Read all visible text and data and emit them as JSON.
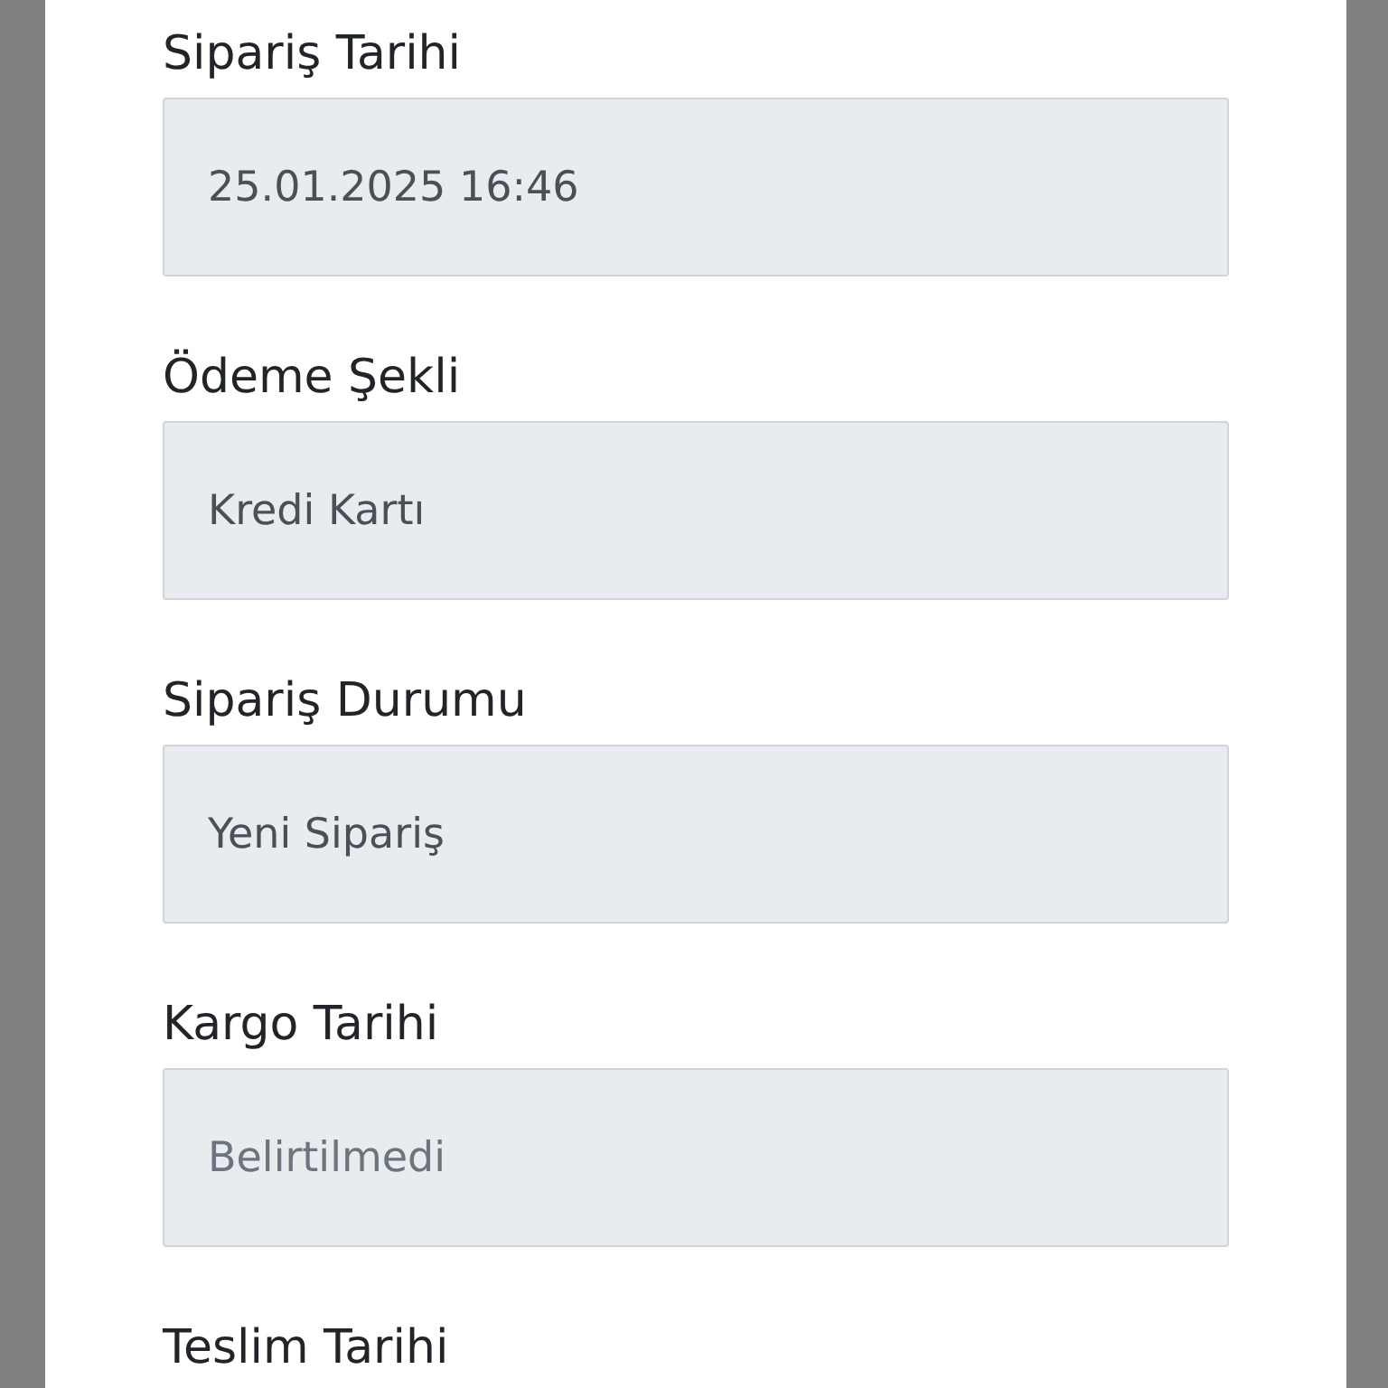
{
  "fields": [
    {
      "label": "Sipariş Tarihi",
      "value": "25.01.2025 16:46"
    },
    {
      "label": "Ödeme Şekli",
      "value": "Kredi Kartı"
    },
    {
      "label": "Sipariş Durumu",
      "value": "Yeni Sipariş"
    },
    {
      "label": "Kargo Tarihi",
      "placeholder": "Belirtilmedi"
    },
    {
      "label": "Teslim Tarihi"
    }
  ]
}
